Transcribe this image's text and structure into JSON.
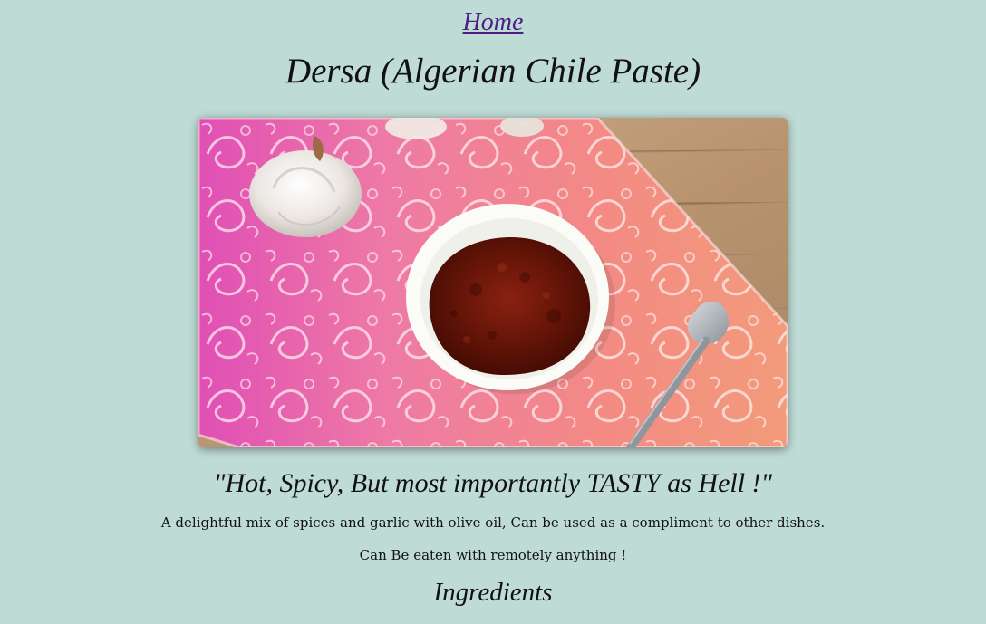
{
  "nav": {
    "home_label": "Home"
  },
  "page": {
    "title": "Dersa (Algerian Chile Paste)",
    "quote": "\"Hot, Spicy, But most importantly TASTY as Hell !\"",
    "description_1": "A delightful mix of spices and garlic with olive oil, Can be used as a compliment to other dishes.",
    "description_2": "Can Be eaten with remotely anything !",
    "section_heading": "Ingredients"
  },
  "colors": {
    "background": "#bfdbd6",
    "link": "#4b1f86",
    "text": "#111111"
  },
  "image": {
    "subject": "bowl-of-chile-paste-photo"
  }
}
